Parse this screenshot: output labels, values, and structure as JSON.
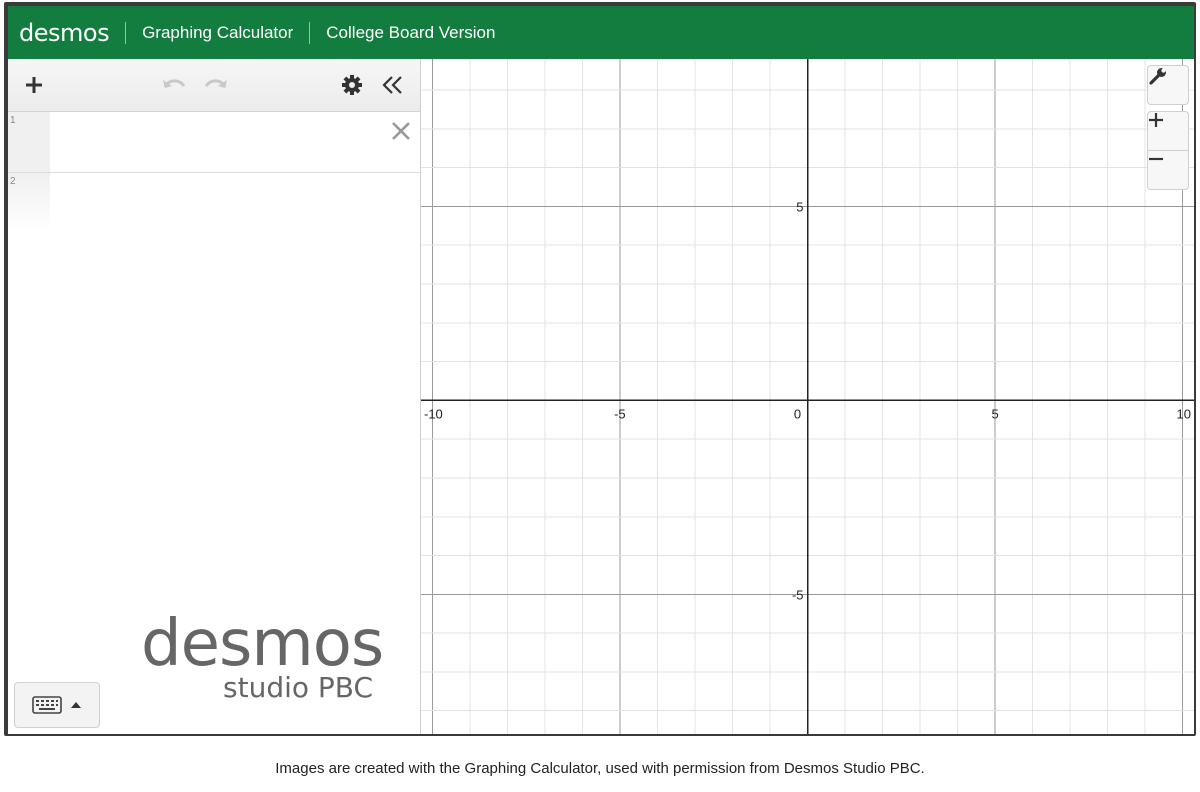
{
  "header": {
    "brand": "desmos",
    "app_title": "Graphing Calculator",
    "version_label": "College Board Version",
    "bg_color": "#127d3e"
  },
  "expression_list": {
    "toolbar": {
      "add_icon": "plus-icon",
      "undo_icon": "undo-icon",
      "redo_icon": "redo-icon",
      "settings_icon": "gear-icon",
      "collapse_icon": "double-chevron-left-icon"
    },
    "rows": [
      {
        "number": "1",
        "value": ""
      },
      {
        "number": "2",
        "value": ""
      }
    ]
  },
  "watermark": {
    "brand": "desmos",
    "sub": "studio PBC"
  },
  "keyboard_toggle": {
    "icon": "keyboard-icon",
    "arrow_icon": "triangle-up-icon"
  },
  "graph": {
    "x_range": [
      -10.3,
      10.3
    ],
    "y_range": [
      -8.6,
      8.8
    ],
    "grid": true,
    "x_ticks": [
      {
        "value": -10,
        "label": "-10"
      },
      {
        "value": -5,
        "label": "-5"
      },
      {
        "value": 0,
        "label": "0"
      },
      {
        "value": 5,
        "label": "5"
      },
      {
        "value": 10,
        "label": "10"
      }
    ],
    "y_ticks": [
      {
        "value": 5,
        "label": "5"
      },
      {
        "value": -5,
        "label": "-5"
      }
    ],
    "controls": {
      "settings_icon": "wrench-icon",
      "zoom_in_icon": "plus-icon",
      "zoom_out_icon": "minus-icon"
    }
  },
  "caption": "Images are created with the Graphing Calculator, used with permission from Desmos Studio PBC."
}
